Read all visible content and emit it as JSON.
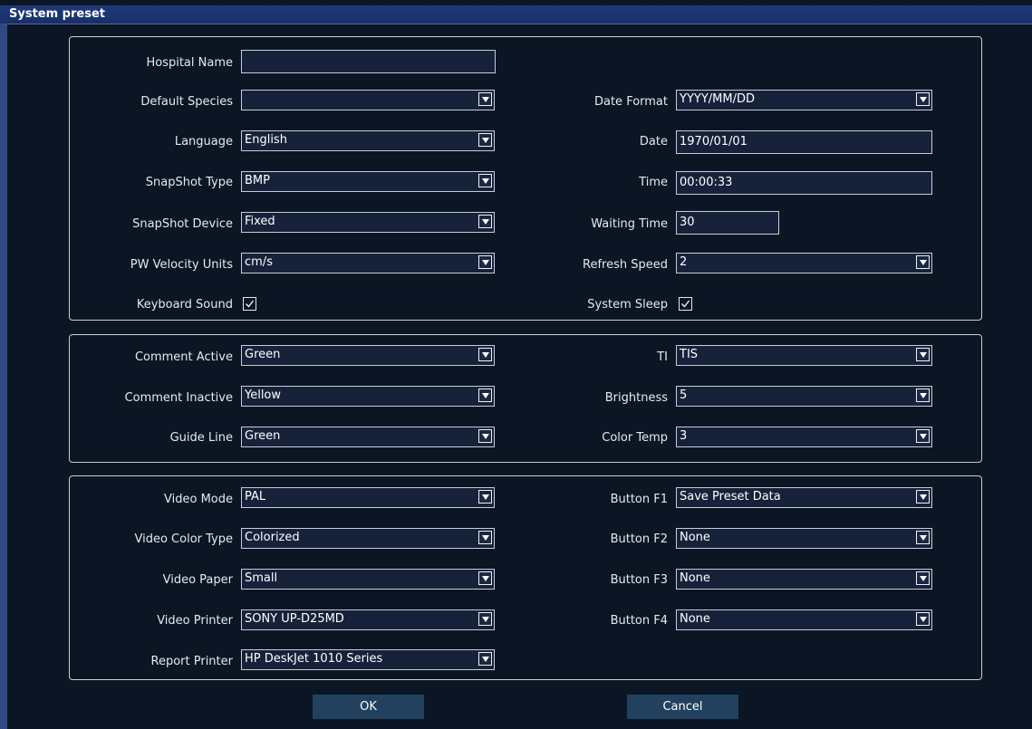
{
  "window": {
    "title": "System preset"
  },
  "general": {
    "hospital_name": {
      "label": "Hospital Name",
      "value": ""
    },
    "default_species": {
      "label": "Default Species",
      "value": ""
    },
    "language": {
      "label": "Language",
      "value": "English"
    },
    "snapshot_type": {
      "label": "SnapShot Type",
      "value": "BMP"
    },
    "snapshot_device": {
      "label": "SnapShot Device",
      "value": "Fixed"
    },
    "pw_velocity_units": {
      "label": "PW Velocity Units",
      "value": "cm/s"
    },
    "keyboard_sound": {
      "label": "Keyboard Sound",
      "checked": true
    },
    "date_format": {
      "label": "Date Format",
      "value": "YYYY/MM/DD"
    },
    "date": {
      "label": "Date",
      "value": "1970/01/01"
    },
    "time": {
      "label": "Time",
      "value": "00:00:33"
    },
    "waiting_time": {
      "label": "Waiting Time",
      "value": "30"
    },
    "refresh_speed": {
      "label": "Refresh Speed",
      "value": "2"
    },
    "system_sleep": {
      "label": "System Sleep",
      "checked": true
    }
  },
  "display": {
    "comment_active": {
      "label": "Comment Active",
      "value": "Green"
    },
    "comment_inactive": {
      "label": "Comment Inactive",
      "value": "Yellow"
    },
    "guide_line": {
      "label": "Guide Line",
      "value": "Green"
    },
    "ti": {
      "label": "TI",
      "value": "TIS"
    },
    "brightness": {
      "label": "Brightness",
      "value": "5"
    },
    "color_temp": {
      "label": "Color Temp",
      "value": "3"
    }
  },
  "peripherals": {
    "video_mode": {
      "label": "Video Mode",
      "value": "PAL"
    },
    "video_color_type": {
      "label": "Video Color Type",
      "value": "Colorized"
    },
    "video_paper": {
      "label": "Video Paper",
      "value": "Small"
    },
    "video_printer": {
      "label": "Video Printer",
      "value": "SONY UP-D25MD"
    },
    "report_printer": {
      "label": "Report Printer",
      "value": "HP DeskJet 1010 Series"
    },
    "button_f1": {
      "label": "Button F1",
      "value": "Save Preset Data"
    },
    "button_f2": {
      "label": "Button F2",
      "value": "None"
    },
    "button_f3": {
      "label": "Button F3",
      "value": "None"
    },
    "button_f4": {
      "label": "Button F4",
      "value": "None"
    }
  },
  "actions": {
    "ok": "OK",
    "cancel": "Cancel"
  }
}
